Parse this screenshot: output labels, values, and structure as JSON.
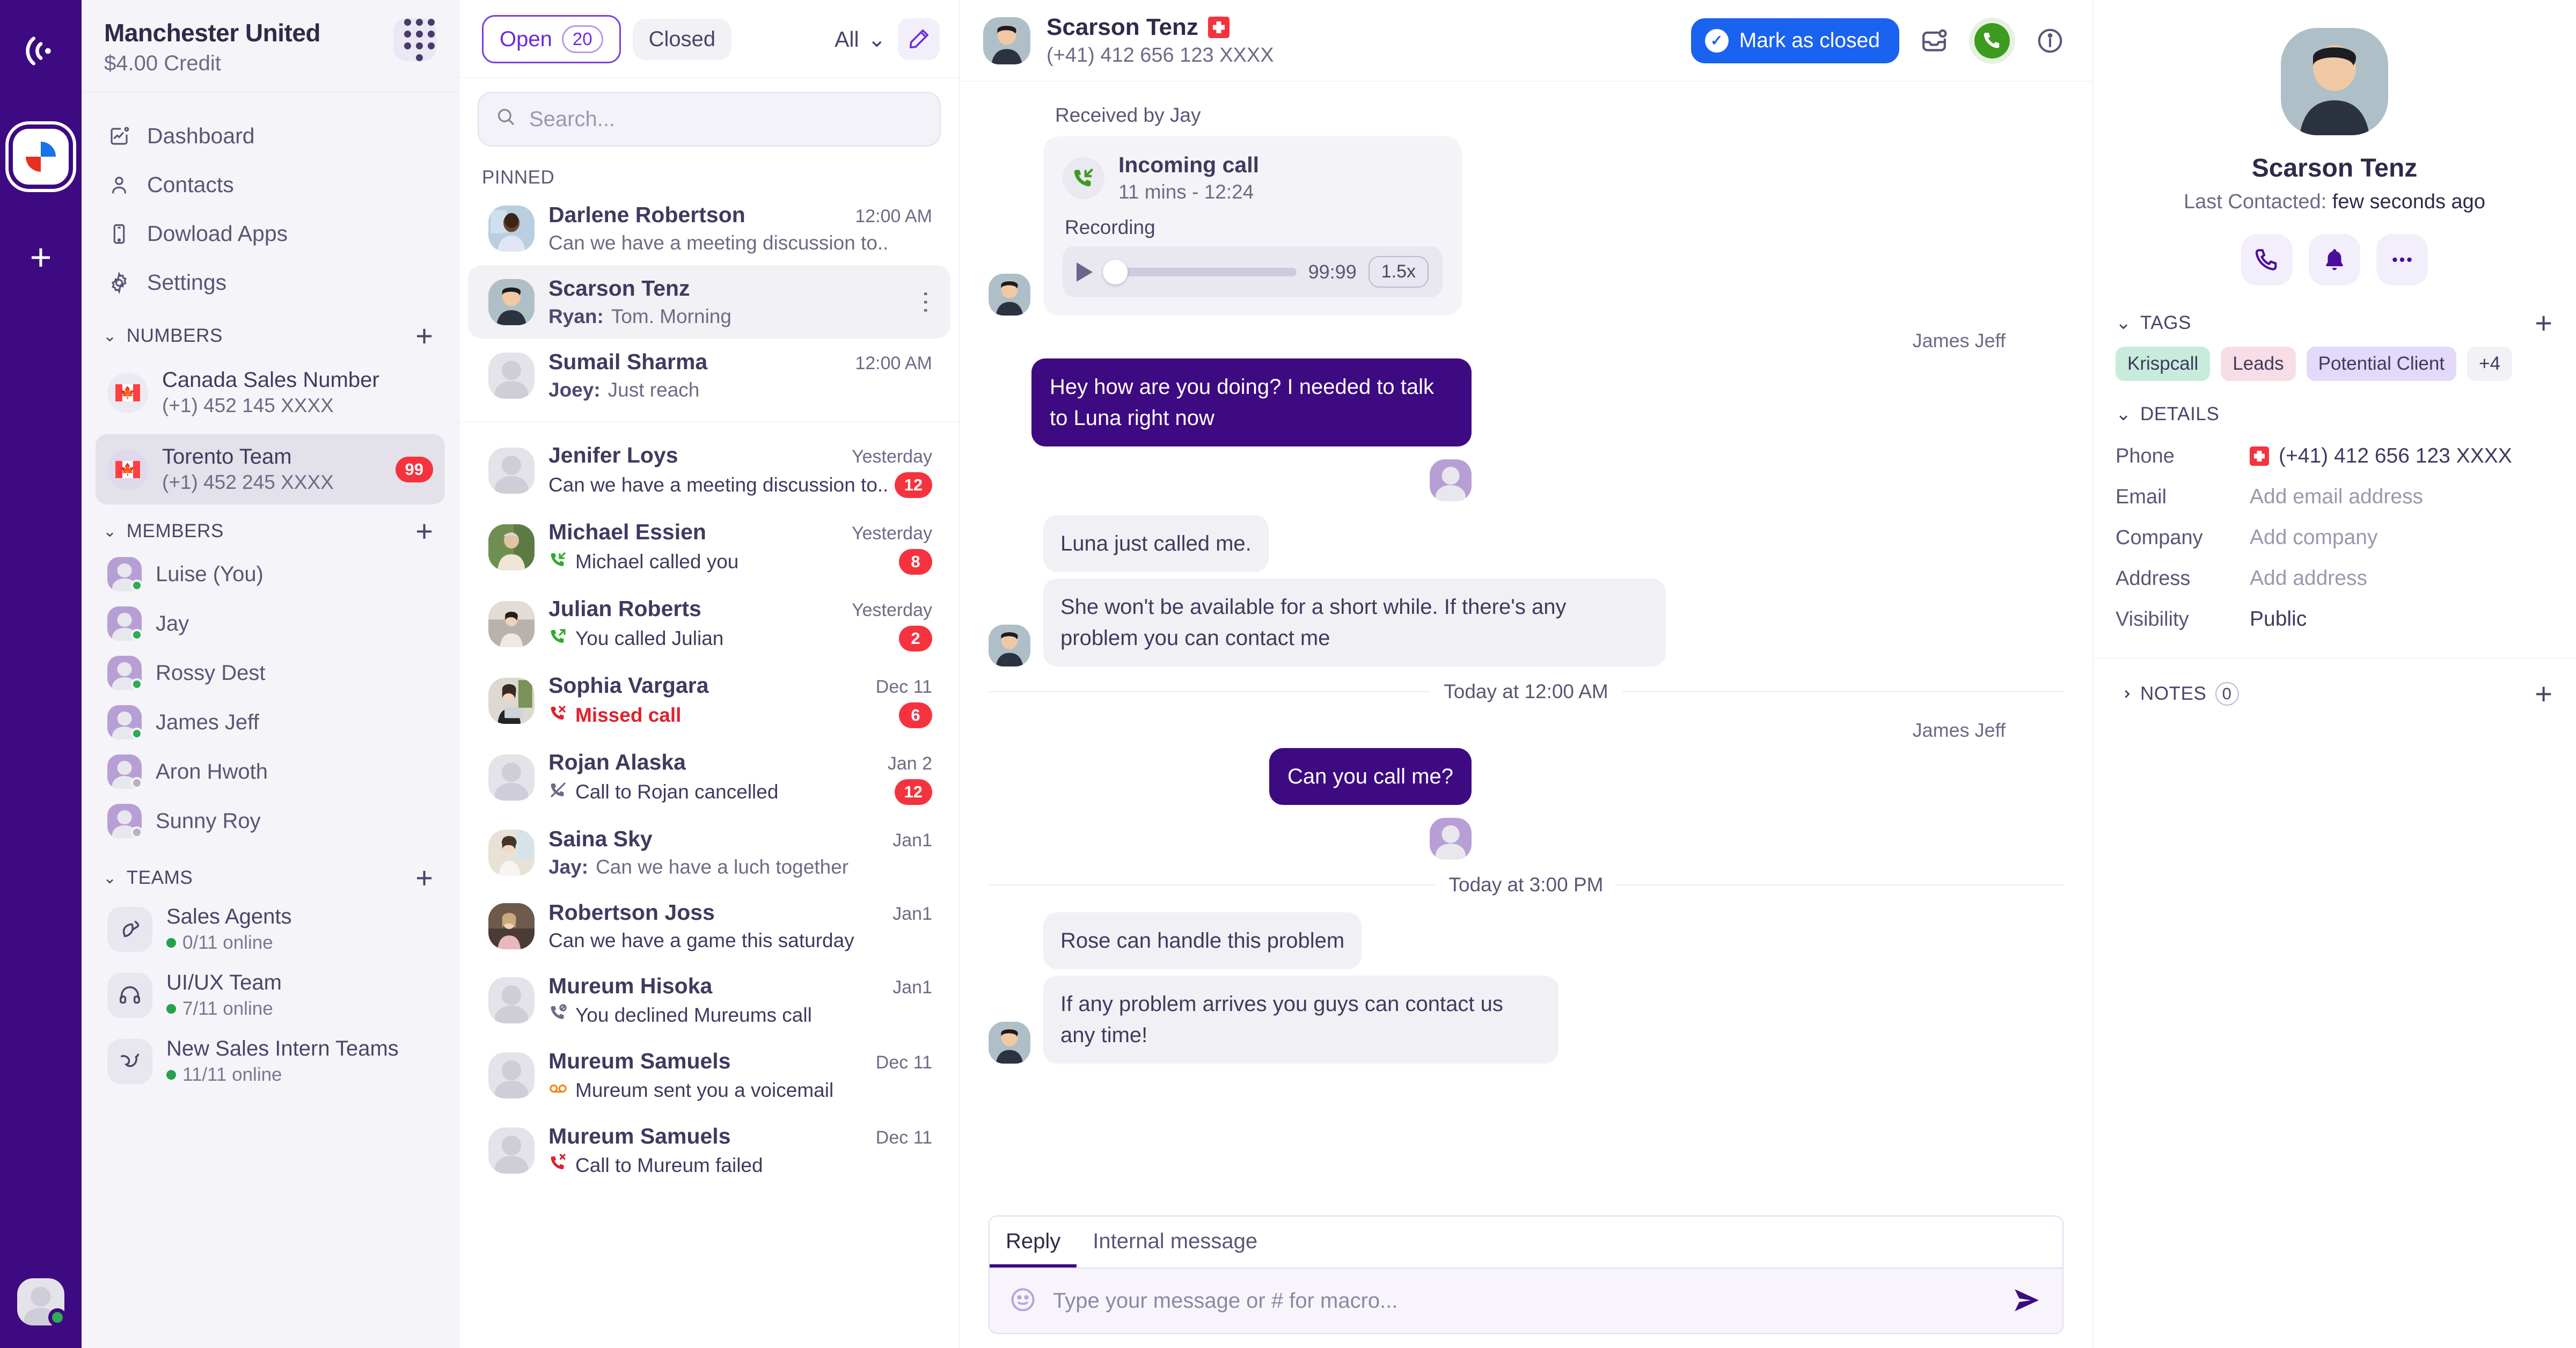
{
  "rail": {
    "logo_icon": "broadcast-icon",
    "app_icon": "krispcall-logo",
    "add_label": "+",
    "avatar_status": "online"
  },
  "sidebar": {
    "workspace_name": "Manchester United",
    "credit": "$4.00 Credit",
    "dialpad_icon": "dialpad-icon",
    "nav": [
      {
        "label": "Dashboard",
        "icon": "dashboard-icon"
      },
      {
        "label": "Contacts",
        "icon": "contacts-icon"
      },
      {
        "label": "Dowload Apps",
        "icon": "mobile-icon"
      },
      {
        "label": "Settings",
        "icon": "gear-icon"
      }
    ],
    "numbers_title": "NUMBERS",
    "numbers": [
      {
        "name": "Canada Sales Number",
        "phone": "(+1) 452 145 XXXX",
        "flag": "canada-flag",
        "badge": "",
        "active": false
      },
      {
        "name": "Torento Team",
        "phone": "(+1) 452 245 XXXX",
        "flag": "canada-flag",
        "badge": "99",
        "active": true
      }
    ],
    "members_title": "MEMBERS",
    "members": [
      {
        "name": "Luise (You)",
        "status": "online"
      },
      {
        "name": "Jay",
        "status": "online"
      },
      {
        "name": "Rossy Dest",
        "status": "online"
      },
      {
        "name": "James Jeff",
        "status": "online"
      },
      {
        "name": "Aron Hwoth",
        "status": "offline"
      },
      {
        "name": "Sunny Roy",
        "status": "offline"
      }
    ],
    "teams_title": "TEAMS",
    "teams": [
      {
        "name": "Sales Agents",
        "online": "0/11 online",
        "icon": "brush-icon"
      },
      {
        "name": "UI/UX Team",
        "online": "7/11 online",
        "icon": "headset-icon"
      },
      {
        "name": "New Sales Intern Teams",
        "online": "11/11 online",
        "icon": "bird-icon"
      }
    ]
  },
  "list": {
    "tab_open": "Open",
    "tab_open_count": "20",
    "tab_closed": "Closed",
    "filter_all": "All",
    "compose_icon": "compose-icon",
    "search_placeholder": "Search...",
    "search_value": "",
    "pinned_label": "PINNED",
    "pinned": [
      {
        "name": "Darlene Robertson",
        "preview": "Can we have a meeting discussion to..",
        "sender": "",
        "time": "12:00 AM",
        "badge": "",
        "icon": "",
        "avatar": "photo-man-blue",
        "selected": false
      },
      {
        "name": "Scarson Tenz",
        "preview": "Tom. Morning",
        "sender": "Ryan:",
        "time": "",
        "badge": "",
        "icon": "",
        "avatar": "photo-scarson",
        "selected": true
      },
      {
        "name": "Sumail Sharma",
        "preview": "Just reach",
        "sender": "Joey:",
        "time": "12:00 AM",
        "badge": "",
        "icon": "",
        "avatar": "generic",
        "selected": false
      }
    ],
    "conversations": [
      {
        "name": "Jenifer Loys",
        "preview": "Can we have a meeting discussion to..",
        "sender": "",
        "time": "Yesterday",
        "badge": "12",
        "icon": "",
        "avatar": "generic"
      },
      {
        "name": "Michael Essien",
        "preview": "Michael called you",
        "sender": "",
        "time": "Yesterday",
        "badge": "8",
        "icon": "incoming-call-icon",
        "avatar": "photo-elder"
      },
      {
        "name": "Julian Roberts",
        "preview": "You called Julian",
        "sender": "",
        "time": "Yesterday",
        "badge": "2",
        "icon": "outgoing-call-icon",
        "avatar": "photo-woman-sofa"
      },
      {
        "name": "Sophia Vargara",
        "preview": "Missed call",
        "sender": "",
        "time": "Dec 11",
        "badge": "6",
        "icon": "missed-call-icon",
        "avatar": "photo-woman-laptop"
      },
      {
        "name": "Rojan Alaska",
        "preview": "Call to Rojan cancelled",
        "sender": "",
        "time": "Jan 2",
        "badge": "12",
        "icon": "cancelled-call-icon",
        "avatar": "generic"
      },
      {
        "name": "Saina Sky",
        "preview": "Can we have a luch together",
        "sender": "Jay:",
        "time": "Jan1",
        "badge": "",
        "icon": "",
        "avatar": "photo-woman-glasses"
      },
      {
        "name": "Robertson Joss",
        "preview": "Can we have a game this saturday",
        "sender": "",
        "time": "Jan1",
        "badge": "",
        "icon": "",
        "avatar": "photo-woman-pink"
      },
      {
        "name": "Mureum Hisoka",
        "preview": "You declined Mureums call",
        "sender": "",
        "time": "Jan1",
        "badge": "",
        "icon": "declined-call-icon",
        "avatar": "generic"
      },
      {
        "name": "Mureum Samuels",
        "preview": "Mureum sent you a voicemail",
        "sender": "",
        "time": "Dec 11",
        "badge": "",
        "icon": "voicemail-icon",
        "avatar": "generic"
      },
      {
        "name": "Mureum Samuels",
        "preview": "Call to Mureum failed",
        "sender": "",
        "time": "Dec 11",
        "badge": "",
        "icon": "failed-call-icon",
        "avatar": "generic"
      }
    ]
  },
  "chat": {
    "contact_name": "Scarson Tenz",
    "contact_flag": "switzerland-flag",
    "contact_phone": "(+41) 412 656 123 XXXX",
    "mark_closed_label": "Mark as closed",
    "icons": {
      "inbox": "inbox-icon",
      "call": "call-icon",
      "info": "info-icon"
    },
    "received_by": "Received by Jay",
    "call_card": {
      "title": "Incoming call",
      "subtitle": "11 mins - 12:24",
      "recording_label": "Recording",
      "duration": "99:99",
      "speed": "1.5x"
    },
    "messages": [
      {
        "type": "out",
        "sender": "James Jeff",
        "text": "Hey how are you doing? I needed to talk to Luna right now"
      },
      {
        "type": "in",
        "sender": "",
        "text": "Luna just called me."
      },
      {
        "type": "in",
        "sender": "",
        "text": "She won't be available for a short while. If there's any problem you can contact me"
      },
      {
        "type": "sep",
        "text": "Today at 12:00 AM"
      },
      {
        "type": "out",
        "sender": "James Jeff",
        "text": "Can you call me?"
      },
      {
        "type": "sep",
        "text": "Today at 3:00 PM"
      },
      {
        "type": "in",
        "sender": "",
        "text": "Rose can handle this problem"
      },
      {
        "type": "in",
        "sender": "",
        "text": "If any problem arrives you guys can contact us any time!"
      }
    ],
    "reply": {
      "tab_reply": "Reply",
      "tab_internal": "Internal message",
      "placeholder": "Type your message or # for macro...",
      "value": "",
      "send_icon": "send-icon",
      "emoji_icon": "emoji-icon"
    }
  },
  "right_panel": {
    "name": "Scarson Tenz",
    "last_contacted_label": "Last Contacted:",
    "last_contacted_value": "few seconds ago",
    "actions": [
      {
        "icon": "phone-icon",
        "name": "call"
      },
      {
        "icon": "bell-icon",
        "name": "notification"
      },
      {
        "icon": "more-icon",
        "name": "more"
      }
    ],
    "tags_title": "TAGS",
    "tags": [
      {
        "label": "Krispcall",
        "color": "#c9ebdc"
      },
      {
        "label": "Leads",
        "color": "#f8dde6"
      },
      {
        "label": "Potential Client",
        "color": "#e3d9f8"
      },
      {
        "label": "+4",
        "color": "#f2f1f5"
      }
    ],
    "details_title": "DETAILS",
    "details": [
      {
        "key": "Phone",
        "value": "(+41) 412 656 123 XXXX",
        "flag": "switzerland-flag",
        "placeholder": false
      },
      {
        "key": "Email",
        "value": "Add email address",
        "flag": "",
        "placeholder": true
      },
      {
        "key": "Company",
        "value": "Add company",
        "flag": "",
        "placeholder": true
      },
      {
        "key": "Address",
        "value": "Add address",
        "flag": "",
        "placeholder": true
      },
      {
        "key": "Visibility",
        "value": "Public",
        "flag": "",
        "placeholder": false
      }
    ],
    "notes_title": "NOTES",
    "notes_count": "0"
  },
  "colors": {
    "brand_purple": "#3d0a81",
    "accent_violet": "#6a2bd9",
    "blue_button": "#1a62f0",
    "badge_red": "#f5333f",
    "call_green": "#3d9b1e",
    "missed_red": "#e0202f"
  }
}
